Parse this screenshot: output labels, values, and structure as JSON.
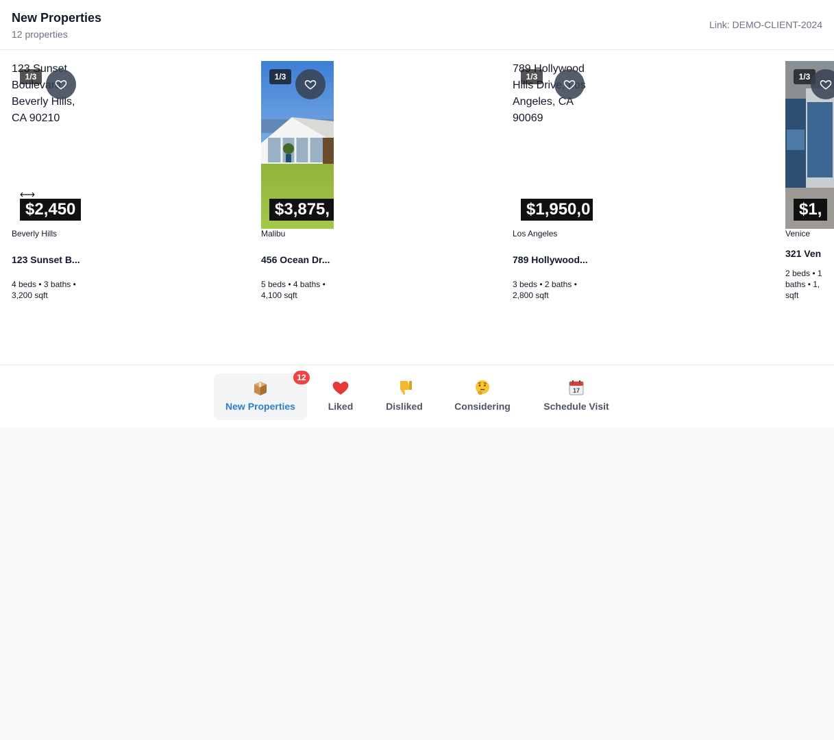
{
  "header": {
    "title": "New Properties",
    "count": "12 properties",
    "link": "Link: DEMO-CLIENT-2024"
  },
  "properties": [
    {
      "image_alt": "123 Sunset Boulevard, Beverly Hills, CA 90210",
      "photo_counter": "1/3",
      "price": "$2,450",
      "city": "Beverly Hills",
      "street": "123 Sunset B...",
      "stats": "4 beds • 3 baths • 3,200 sqft",
      "image_loaded": false
    },
    {
      "image_alt": "",
      "photo_counter": "1/3",
      "price": "$3,875,",
      "city": "Malibu",
      "street": "456 Ocean Dr...",
      "stats": "5 beds • 4 baths • 4,100 sqft",
      "image_loaded": true
    },
    {
      "image_alt": "789 Hollywood Hills Drive, Los Angeles, CA 90069",
      "photo_counter": "1/3",
      "price": "$1,950,0",
      "city": "Los Angeles",
      "street": "789 Hollywood...",
      "stats": "3 beds • 2 baths • 2,800 sqft",
      "image_loaded": false
    },
    {
      "image_alt": "",
      "photo_counter": "1/3",
      "price": "$1,",
      "city": "Venice",
      "street": "321 Ven",
      "stats": "2 beds • 1 baths • 1, sqft",
      "image_loaded": true
    }
  ],
  "nav": {
    "items": [
      {
        "label": "New Properties",
        "icon": "package-icon",
        "badge": "12",
        "active": true
      },
      {
        "label": "Liked",
        "icon": "heart-icon",
        "active": false
      },
      {
        "label": "Disliked",
        "icon": "thumbs-down-icon",
        "active": false
      },
      {
        "label": "Considering",
        "icon": "thinking-face-icon",
        "active": false
      },
      {
        "label": "Schedule Visit",
        "icon": "calendar-icon",
        "calendar_day": "17",
        "active": false
      }
    ]
  },
  "colors": {
    "accent": "#2f7ec9",
    "badge": "#ef4444",
    "price_bg": "#111111"
  }
}
